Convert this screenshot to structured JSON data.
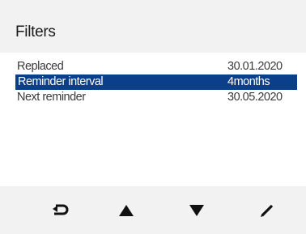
{
  "header": {
    "title": "Filters"
  },
  "rows": [
    {
      "label": "Replaced",
      "value": "30.01.2020",
      "selected": false
    },
    {
      "label": "Reminder interval",
      "value": "4months",
      "selected": true
    },
    {
      "label": "Next reminder",
      "value": "30.05.2020",
      "selected": false
    }
  ],
  "toolbar": {
    "buttons": [
      {
        "icon": "back-arrow-icon"
      },
      {
        "icon": "arrow-up-icon"
      },
      {
        "icon": "arrow-down-icon"
      },
      {
        "icon": "edit-pencil-icon"
      }
    ]
  },
  "colors": {
    "selection": "#0b3f8a",
    "header_bg": "#f2f2f2",
    "icon": "#111111"
  }
}
